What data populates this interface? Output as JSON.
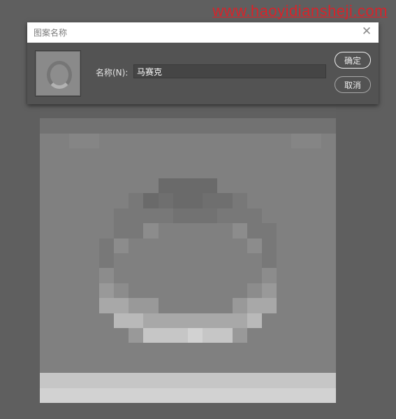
{
  "watermark": "www.haoyidiansheji.com",
  "dialog": {
    "title": "图案名称",
    "close_icon": "close-icon",
    "name_label": "名称(N):",
    "name_value": "马赛克",
    "ok_label": "确定",
    "cancel_label": "取消"
  },
  "pattern": {
    "colors": {
      "a": "#606060",
      "b": "#727272",
      "c": "#808080",
      "d": "#858585",
      "e": "#6a6a6a",
      "f": "#787878",
      "g": "#8c8c8c",
      "h": "#999999",
      "i": "#a8a8a8",
      "j": "#b9b9b9",
      "k": "#c6c6c6",
      "m": "#d2d2d2",
      "n": "#6f6f6f"
    },
    "rows": [
      "aaaaaaaaaaaaaaaaaaaa",
      "bbbbbbbbbbbbbbbbbbbb",
      "ccddcccccccccccccddc",
      "cccccccccccccccccccc",
      "ccccccccccccccccccc c",
      "cccccccceeeeccccccccc",
      "ccccccfeneennfcccccc",
      "cccccffffbbbfffccccc",
      "cccccffgcccccgffcccc",
      "ccccfgccccccccgfcccc",
      "ccccfccccccccccfcccc",
      "ccccgccccccccccgcccc",
      "cccchgccccccccghcccc",
      "cccciihhccccchiicccc",
      "cccccjjiiiiiiijccccc",
      "cccccchkkkmkkhcccccc",
      "cccccccccccccccccccc",
      "cccccccccccccccccccc",
      "kkkkkkkkkkkkkkkkkkkk",
      "mmmmmmmmmmmmmmmmmmmm"
    ]
  }
}
